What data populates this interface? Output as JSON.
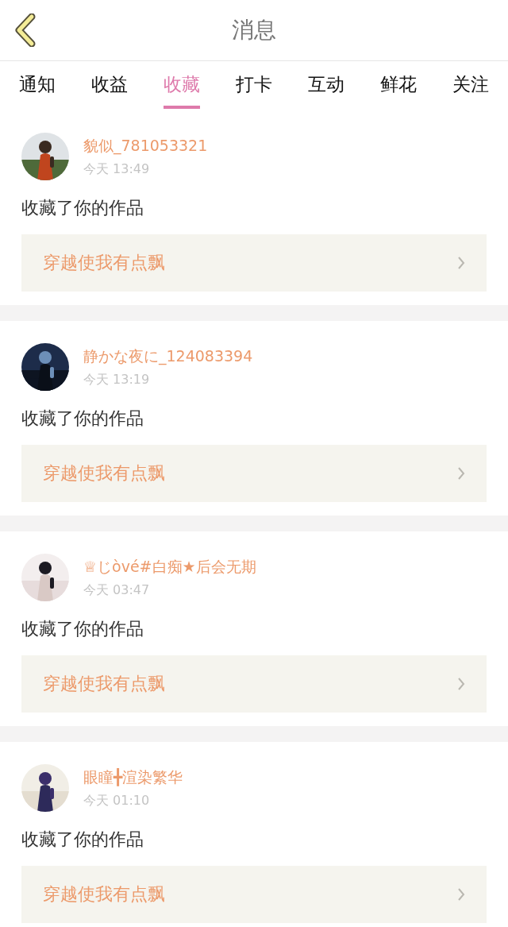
{
  "header": {
    "title": "消息"
  },
  "tabs": [
    {
      "label": "通知",
      "selected": false
    },
    {
      "label": "收益",
      "selected": false
    },
    {
      "label": "收藏",
      "selected": true
    },
    {
      "label": "打卡",
      "selected": false
    },
    {
      "label": "互动",
      "selected": false
    },
    {
      "label": "鲜花",
      "selected": false
    },
    {
      "label": "关注",
      "selected": false
    }
  ],
  "messages": [
    {
      "user": "貌似_781053321",
      "time": "今天 13:49",
      "action": "收藏了你的作品",
      "work": "穿越使我有点飘"
    },
    {
      "user": "静かな夜に_124083394",
      "time": "今天 13:19",
      "action": "收藏了你的作品",
      "work": "穿越使我有点飘"
    },
    {
      "user": "♕じòvé#白痴★后会无期",
      "time": "今天 03:47",
      "action": "收藏了你的作品",
      "work": "穿越使我有点飘"
    },
    {
      "user": "眼瞳╋渲染繁华",
      "time": "今天 01:10",
      "action": "收藏了你的作品",
      "work": "穿越使我有点飘"
    }
  ]
}
